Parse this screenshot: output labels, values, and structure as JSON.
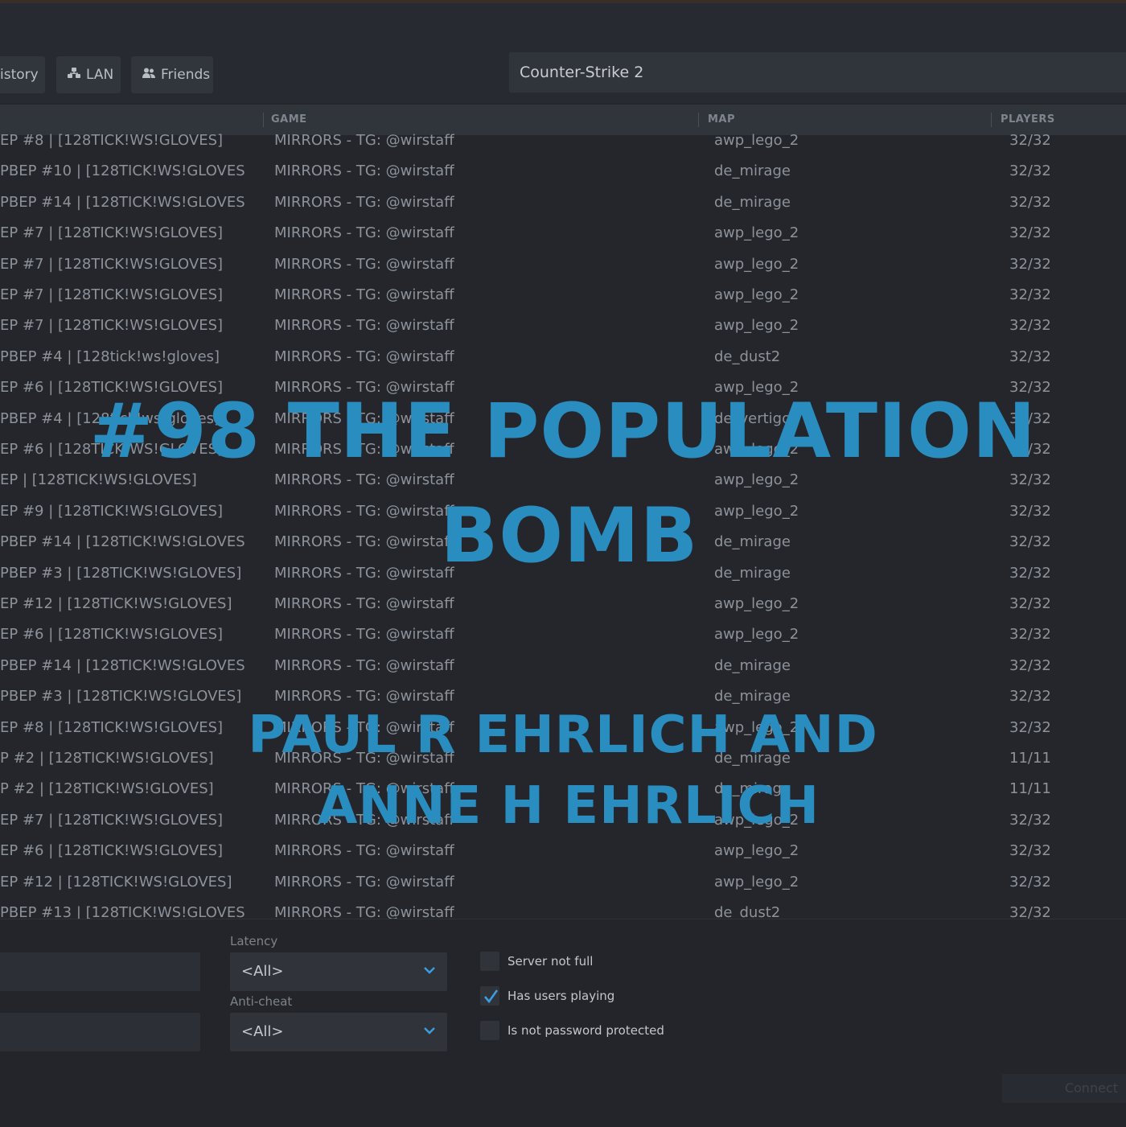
{
  "tabs": [
    {
      "label": "istory"
    },
    {
      "label": "LAN"
    },
    {
      "label": "Friends"
    }
  ],
  "search": {
    "value": "Counter-Strike 2"
  },
  "columns": {
    "game": "GAME",
    "map": "MAP",
    "players": "PLAYERS"
  },
  "servers": [
    {
      "name": "EP #8 | [128TICK!WS!GLOVES]",
      "game": "MIRRORS - TG: @wirstaff",
      "map": "awp_lego_2",
      "players": "32/32"
    },
    {
      "name": "PBEP #10 | [128TICK!WS!GLOVES",
      "game": "MIRRORS - TG: @wirstaff",
      "map": "de_mirage",
      "players": "32/32"
    },
    {
      "name": "PBEP #14 | [128TICK!WS!GLOVES",
      "game": "MIRRORS - TG: @wirstaff",
      "map": "de_mirage",
      "players": "32/32"
    },
    {
      "name": "EP #7 | [128TICK!WS!GLOVES]",
      "game": "MIRRORS - TG: @wirstaff",
      "map": "awp_lego_2",
      "players": "32/32"
    },
    {
      "name": "EP #7 | [128TICK!WS!GLOVES]",
      "game": "MIRRORS - TG: @wirstaff",
      "map": "awp_lego_2",
      "players": "32/32"
    },
    {
      "name": "EP #7 | [128TICK!WS!GLOVES]",
      "game": "MIRRORS - TG: @wirstaff",
      "map": "awp_lego_2",
      "players": "32/32"
    },
    {
      "name": "EP #7 | [128TICK!WS!GLOVES]",
      "game": "MIRRORS - TG: @wirstaff",
      "map": "awp_lego_2",
      "players": "32/32"
    },
    {
      "name": "PBEP #4 | [128tick!ws!gloves]",
      "game": "MIRRORS - TG: @wirstaff",
      "map": "de_dust2",
      "players": "32/32"
    },
    {
      "name": "EP #6 | [128TICK!WS!GLOVES]",
      "game": "MIRRORS - TG: @wirstaff",
      "map": "awp_lego_2",
      "players": "32/32"
    },
    {
      "name": "PBEP #4 | [128tick!ws!gloves]",
      "game": "MIRRORS - TG: @wirstaff",
      "map": "de_vertigo",
      "players": "32/32"
    },
    {
      "name": "EP #6 | [128TICK!WS!GLOVES]",
      "game": "MIRRORS - TG: @wirstaff",
      "map": "awp_lego_2",
      "players": "32/32"
    },
    {
      "name": "EP | [128TICK!WS!GLOVES]",
      "game": "MIRRORS - TG: @wirstaff",
      "map": "awp_lego_2",
      "players": "32/32"
    },
    {
      "name": "EP #9 | [128TICK!WS!GLOVES]",
      "game": "MIRRORS - TG: @wirstaff",
      "map": "awp_lego_2",
      "players": "32/32"
    },
    {
      "name": "PBEP #14 | [128TICK!WS!GLOVES",
      "game": "MIRRORS - TG: @wirstaff",
      "map": "de_mirage",
      "players": "32/32"
    },
    {
      "name": "PBEP #3 | [128TICK!WS!GLOVES]",
      "game": "MIRRORS - TG: @wirstaff",
      "map": "de_mirage",
      "players": "32/32"
    },
    {
      "name": "EP #12 | [128TICK!WS!GLOVES]",
      "game": "MIRRORS - TG: @wirstaff",
      "map": "awp_lego_2",
      "players": "32/32"
    },
    {
      "name": "EP #6 | [128TICK!WS!GLOVES]",
      "game": "MIRRORS - TG: @wirstaff",
      "map": "awp_lego_2",
      "players": "32/32"
    },
    {
      "name": "PBEP #14 | [128TICK!WS!GLOVES",
      "game": "MIRRORS - TG: @wirstaff",
      "map": "de_mirage",
      "players": "32/32"
    },
    {
      "name": "PBEP #3 | [128TICK!WS!GLOVES]",
      "game": "MIRRORS - TG: @wirstaff",
      "map": "de_mirage",
      "players": "32/32"
    },
    {
      "name": "EP #8 | [128TICK!WS!GLOVES]",
      "game": "MIRRORS - TG: @wirstaff",
      "map": "awp_lego_2",
      "players": "32/32"
    },
    {
      "name": "P #2 | [128TICK!WS!GLOVES]",
      "game": "MIRRORS - TG: @wirstaff",
      "map": "de_mirage",
      "players": "11/11"
    },
    {
      "name": "P #2 | [128TICK!WS!GLOVES]",
      "game": "MIRRORS - TG: @wirstaff",
      "map": "de_mirage",
      "players": "11/11"
    },
    {
      "name": "EP #7 | [128TICK!WS!GLOVES]",
      "game": "MIRRORS - TG: @wirstaff",
      "map": "awp_lego_2",
      "players": "32/32"
    },
    {
      "name": "EP #6 | [128TICK!WS!GLOVES]",
      "game": "MIRRORS - TG: @wirstaff",
      "map": "awp_lego_2",
      "players": "32/32"
    },
    {
      "name": "EP #12 | [128TICK!WS!GLOVES]",
      "game": "MIRRORS - TG: @wirstaff",
      "map": "awp_lego_2",
      "players": "32/32"
    },
    {
      "name": "PBEP #13 | [128TICK!WS!GLOVES",
      "game": "MIRRORS - TG: @wirstaff",
      "map": "de_dust2",
      "players": "32/32"
    }
  ],
  "filters": {
    "latency_label": "Latency",
    "latency_value": "<All>",
    "anticheat_label": "Anti-cheat",
    "anticheat_value": "<All>",
    "checks": [
      {
        "label": "Server not full",
        "checked": false
      },
      {
        "label": "Has users playing",
        "checked": true
      },
      {
        "label": "Is not password protected",
        "checked": false
      }
    ],
    "connect_label": "Connect"
  },
  "overlay": {
    "title_line1": "#98 THE POPULATION",
    "title_line2": "BOMB",
    "author_line1": "PAUL R EHRLICH AND",
    "author_line2": "ANNE H EHRLICH"
  },
  "colors": {
    "accent": "#2a8dc0",
    "check": "#3a9ee0"
  }
}
